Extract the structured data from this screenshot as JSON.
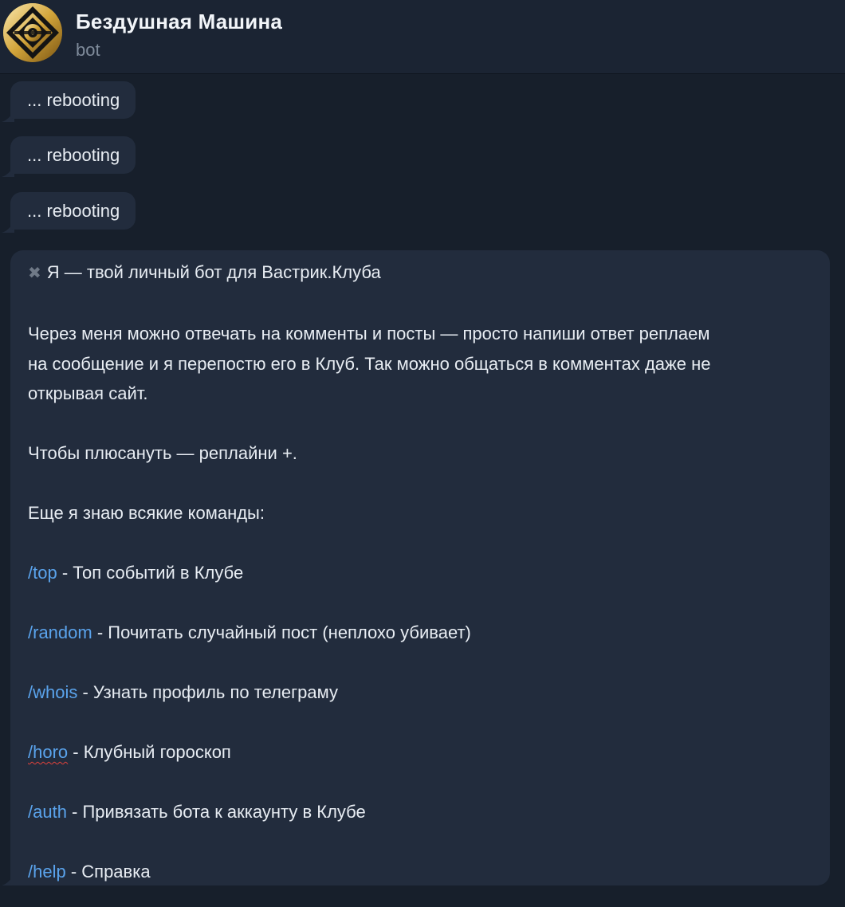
{
  "header": {
    "title": "Бездушная Машина",
    "subtitle": "bot"
  },
  "messages": {
    "reboot1": "... rebooting",
    "reboot2": "... rebooting",
    "reboot3": "... rebooting",
    "main": {
      "intro_icon": "x-icon",
      "intro": "Я — твой личный бот для Вастрик.Клуба",
      "p1_line1": "Через меня можно отвечать на комменты и посты — просто напиши ответ реплаем",
      "p1_line2": "на сообщение и я перепостю его в Клуб. Так можно общаться в комментах даже не",
      "p1_line3": "открывая сайт.",
      "plus_line": "Чтобы плюсануть — реплайни +.",
      "commands_intro": "Еще я знаю всякие команды:",
      "commands": [
        {
          "cmd": "/top",
          "desc": " - Топ событий в Клубе"
        },
        {
          "cmd": "/random",
          "desc": " - Почитать случайный пост (неплохо убивает)"
        },
        {
          "cmd": "/whois",
          "desc": " - Узнать профиль по телеграму"
        },
        {
          "cmd": "/horo",
          "desc": " - Клубный гороскоп"
        },
        {
          "cmd": "/auth",
          "desc": " - Привязать бота к аккаунту в Клубе"
        },
        {
          "cmd": "/help",
          "desc": " - Справка"
        }
      ]
    }
  },
  "colors": {
    "background": "#171f2b",
    "bubble": "#222c3d",
    "link": "#5aa3ec",
    "muted": "#7f8b9b"
  }
}
